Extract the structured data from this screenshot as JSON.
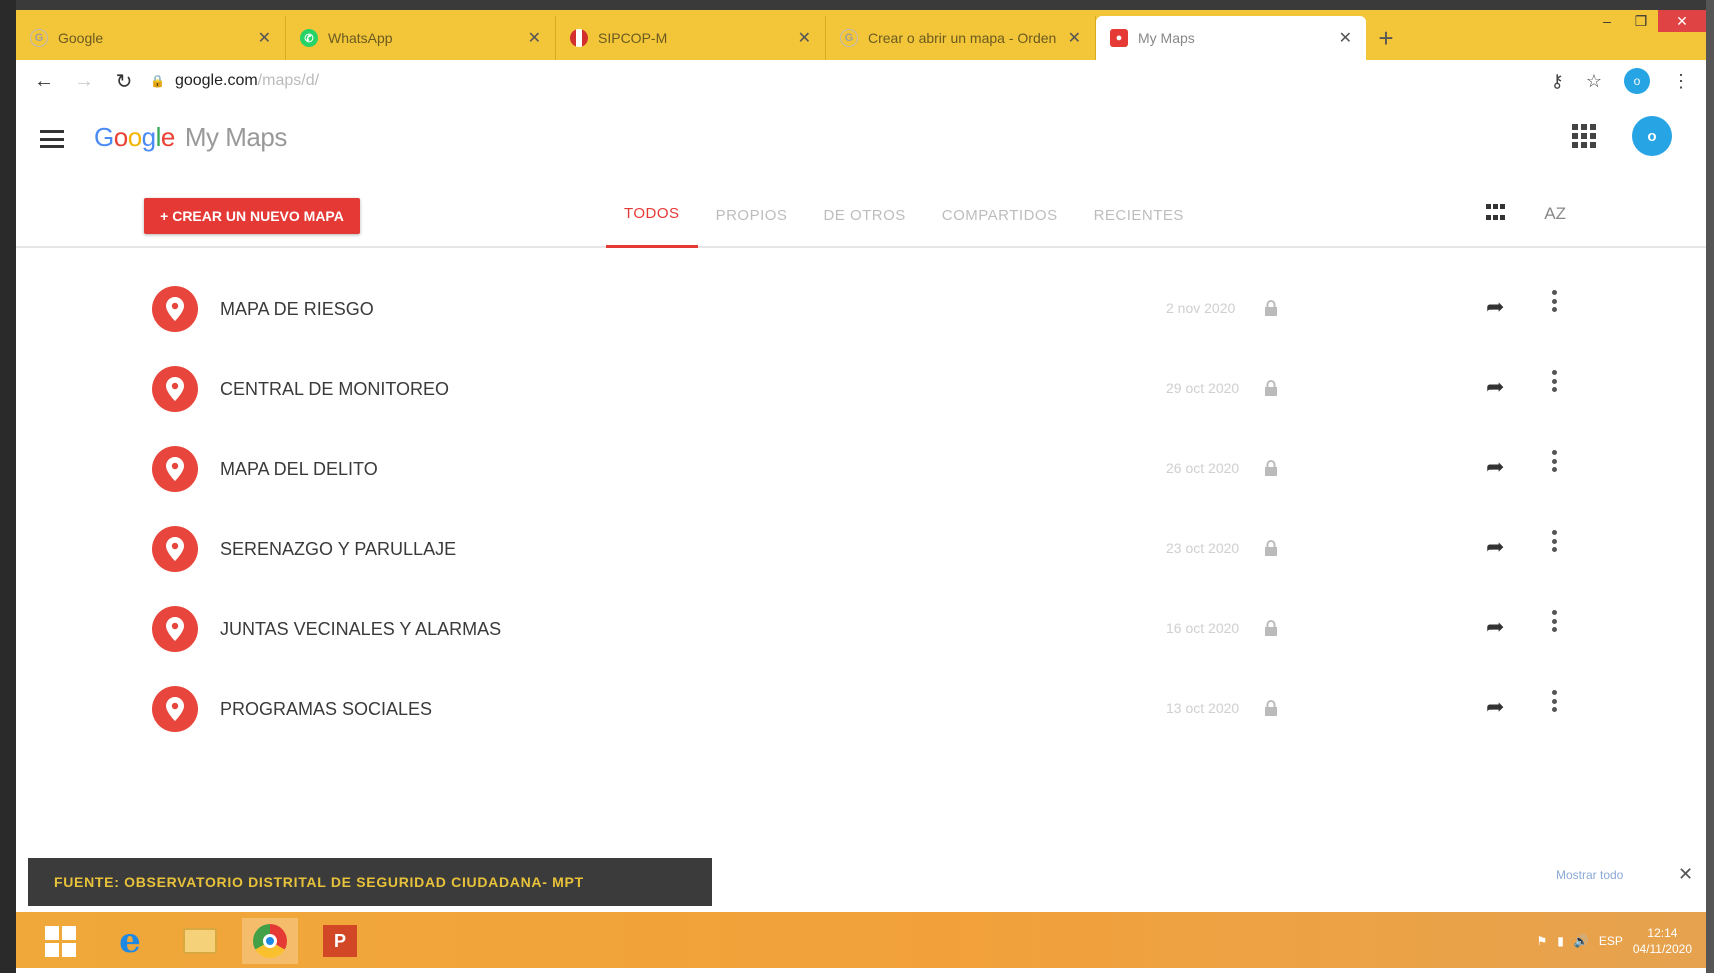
{
  "browser": {
    "tabs": [
      {
        "label": "Google",
        "favicon": "google-icon",
        "color": "#9e9e9e"
      },
      {
        "label": "WhatsApp",
        "favicon": "whatsapp-icon",
        "color": "#25d366"
      },
      {
        "label": "SIPCOP-M",
        "favicon": "peru-flag-icon",
        "color": "#d32f2f"
      },
      {
        "label": "Crear o abrir un mapa - Orden",
        "favicon": "google-icon",
        "color": "#9e9e9e"
      },
      {
        "label": "My Maps",
        "favicon": "mymaps-icon",
        "color": "#e53935"
      }
    ],
    "url_domain": "google.com",
    "url_path": "/maps/d/",
    "profile_initial": "o"
  },
  "app": {
    "logo_google": "Google",
    "logo_product": "My Maps",
    "account_initial": "o"
  },
  "filters": {
    "create_button": "+ CREAR UN NUEVO MAPA",
    "tabs": [
      "TODOS",
      "PROPIOS",
      "DE OTROS",
      "COMPARTIDOS",
      "RECIENTES"
    ],
    "selected_tab": "TODOS",
    "sort_label": "AZ"
  },
  "maps": [
    {
      "title": "MAPA DE RIESGO",
      "date": "2 nov 2020"
    },
    {
      "title": "CENTRAL DE MONITOREO",
      "date": "29 oct 2020"
    },
    {
      "title": "MAPA DEL DELITO",
      "date": "26 oct 2020"
    },
    {
      "title": "SERENAZGO Y PARULLAJE",
      "date": "23 oct 2020"
    },
    {
      "title": "JUNTAS VECINALES Y ALARMAS",
      "date": "16 oct 2020"
    },
    {
      "title": "PROGRAMAS SOCIALES",
      "date": "13 oct 2020"
    }
  ],
  "downloads": {
    "caption": "FUENTE: OBSERVATORIO DISTRITAL DE SEGURIDAD CIUDADANA- MPT",
    "show_all": "Mostrar todo"
  },
  "taskbar": {
    "lang": "ESP",
    "time": "12:14",
    "date": "04/11/2020"
  },
  "colors": {
    "accent": "#e53935",
    "tabstrip": "#f3c63a",
    "avatar": "#27a4e4"
  }
}
